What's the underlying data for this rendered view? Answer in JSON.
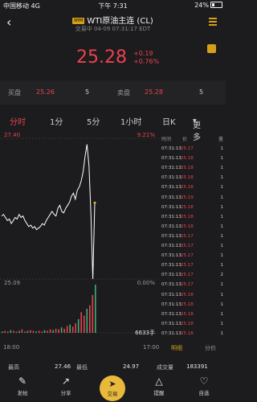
{
  "status": {
    "carrier": "中国移动",
    "network": "4G",
    "time": "下午 7:31",
    "battery": "24%"
  },
  "header": {
    "tag": "NYM",
    "title": "WTI原油主连 (CL)",
    "subtitle": "交易中 04-09 07:31:17 EDT"
  },
  "quote": {
    "price": "25.28",
    "change": "+0.19",
    "change_pct": "+0.76%"
  },
  "bidask": {
    "bid_label": "买盘",
    "bid_price": "25.26",
    "bid_size": "5",
    "ask_label": "卖盘",
    "ask_price": "25.28",
    "ask_size": "5"
  },
  "tabs": [
    "分时",
    "1分",
    "5分",
    "1小时",
    "日K",
    "更多"
  ],
  "chart": {
    "top_left": "27.40",
    "top_right": "9.21%",
    "mid_left": "25.09",
    "mid_right": "0.00%",
    "vol_label": "6633手",
    "x_start": "18:00",
    "x_end": "17:00"
  },
  "chart_data": {
    "type": "line",
    "title": "",
    "xlabel": "",
    "ylabel": "",
    "x_ticks": [
      "18:00",
      "17:00"
    ],
    "ylim": [
      22.78,
      27.4
    ],
    "y_pct_range": [
      "-9.21%",
      "9.21%"
    ],
    "prev_close": 25.09,
    "series": [
      {
        "values": [
          24.85,
          24.9,
          24.8,
          24.7,
          24.75,
          24.6,
          24.7,
          24.8,
          24.75,
          24.9,
          24.8,
          24.85,
          24.7,
          24.6,
          24.5,
          24.55,
          24.45,
          24.5,
          24.4,
          24.45,
          24.5,
          24.6,
          24.55,
          24.7,
          24.8,
          24.9,
          25.0,
          24.9,
          24.85,
          25.1,
          25.2,
          25.0,
          24.95,
          25.1,
          25.2,
          25.3,
          25.5,
          25.6,
          25.4,
          25.7,
          25.8,
          26.0,
          26.3,
          26.8,
          27.2,
          26.5,
          24.9,
          22.78,
          25.28
        ]
      }
    ],
    "volume": [
      2,
      3,
      2,
      4,
      3,
      2,
      3,
      5,
      2,
      3,
      4,
      3,
      2,
      3,
      2,
      4,
      3,
      5,
      4,
      6,
      5,
      8,
      6,
      10,
      12,
      9,
      14,
      20,
      30,
      25,
      35,
      40,
      55,
      70
    ]
  },
  "ticks": {
    "header_time": "时间",
    "header_price": "价",
    "header_vol": "量",
    "rows": [
      {
        "t": "07:31:13",
        "p": "25.17",
        "v": "1"
      },
      {
        "t": "07:31:13",
        "p": "25.18",
        "v": "1"
      },
      {
        "t": "07:31:13",
        "p": "25.18",
        "v": "1"
      },
      {
        "t": "07:31:13",
        "p": "25.18",
        "v": "1"
      },
      {
        "t": "07:31:13",
        "p": "25.18",
        "v": "1"
      },
      {
        "t": "07:31:13",
        "p": "25.19",
        "v": "1"
      },
      {
        "t": "07:31:13",
        "p": "25.18",
        "v": "1"
      },
      {
        "t": "07:31:13",
        "p": "25.18",
        "v": "1"
      },
      {
        "t": "07:31:13",
        "p": "25.18",
        "v": "1"
      },
      {
        "t": "07:31:13",
        "p": "25.17",
        "v": "1"
      },
      {
        "t": "07:31:13",
        "p": "25.17",
        "v": "1"
      },
      {
        "t": "07:31:13",
        "p": "25.17",
        "v": "1"
      },
      {
        "t": "07:31:13",
        "p": "25.17",
        "v": "1"
      },
      {
        "t": "07:31:13",
        "p": "25.17",
        "v": "2"
      },
      {
        "t": "07:31:13",
        "p": "25.17",
        "v": "1"
      },
      {
        "t": "07:31:13",
        "p": "25.18",
        "v": "1"
      },
      {
        "t": "07:31:13",
        "p": "25.18",
        "v": "1"
      },
      {
        "t": "07:31:13",
        "p": "25.18",
        "v": "1"
      },
      {
        "t": "07:31:13",
        "p": "25.18",
        "v": "1"
      },
      {
        "t": "07:31:13",
        "p": "25.18",
        "v": "1"
      }
    ],
    "tab_detail": "明细",
    "tab_price": "分价"
  },
  "stats": {
    "high_label": "最高",
    "high": "27.46",
    "low_label": "最低",
    "low": "24.97",
    "vol_label": "成交量",
    "vol": "183391"
  },
  "nav": {
    "post": "发帖",
    "share": "分享",
    "trade": "交易",
    "alert": "提醒",
    "watch": "自选"
  },
  "colors": {
    "up": "#e8424f",
    "gold": "#e8b93a",
    "bg": "#1c1c1e"
  }
}
